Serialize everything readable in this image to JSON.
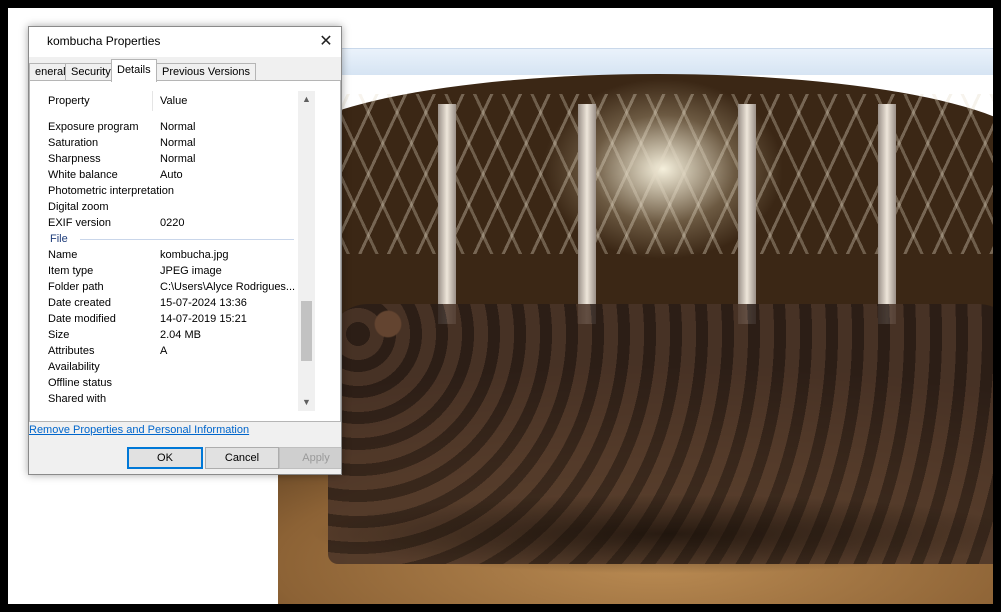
{
  "dialog": {
    "title": "kombucha Properties",
    "close_glyph": "✕",
    "tabs": [
      {
        "label": "eneral"
      },
      {
        "label": "Security"
      },
      {
        "label": "Details"
      },
      {
        "label": "Previous Versions"
      }
    ],
    "active_tab": "Details",
    "columns": {
      "property": "Property",
      "value": "Value"
    },
    "rows_before": [
      {
        "property": "Exposure program",
        "value": "Normal"
      },
      {
        "property": "Saturation",
        "value": "Normal"
      },
      {
        "property": "Sharpness",
        "value": "Normal"
      },
      {
        "property": "White balance",
        "value": "Auto"
      },
      {
        "property": "Photometric interpretation",
        "value": ""
      },
      {
        "property": "Digital zoom",
        "value": ""
      },
      {
        "property": "EXIF version",
        "value": "0220"
      }
    ],
    "group_file": "File",
    "rows_after": [
      {
        "property": "Name",
        "value": "kombucha.jpg"
      },
      {
        "property": "Item type",
        "value": "JPEG image"
      },
      {
        "property": "Folder path",
        "value": "C:\\Users\\Alyce Rodrigues...."
      },
      {
        "property": "Date created",
        "value": "15-07-2024 13:36"
      },
      {
        "property": "Date modified",
        "value": "14-07-2019 15:21"
      },
      {
        "property": "Size",
        "value": "2.04 MB"
      },
      {
        "property": "Attributes",
        "value": "A"
      },
      {
        "property": "Availability",
        "value": ""
      },
      {
        "property": "Offline status",
        "value": ""
      },
      {
        "property": "Shared with",
        "value": ""
      }
    ],
    "remove_link": "Remove Properties and Personal Information",
    "buttons": {
      "ok": "OK",
      "cancel": "Cancel",
      "apply": "Apply"
    },
    "scroll_up": "▲",
    "scroll_down": "▼"
  },
  "colors": {
    "accent": "#0078d7",
    "link": "#0066cc"
  }
}
